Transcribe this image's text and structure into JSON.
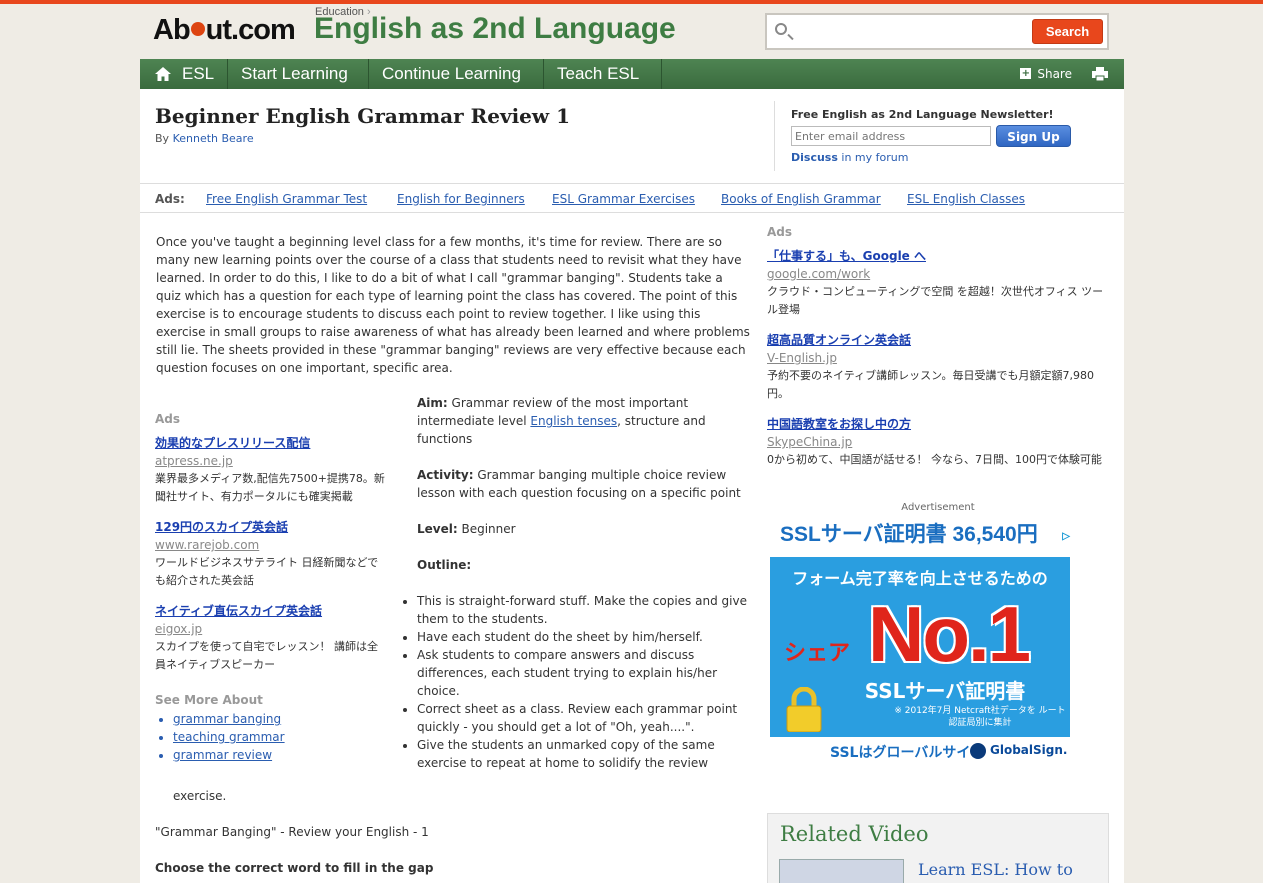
{
  "header": {
    "logo_text_pre": "Ab",
    "logo_text_post": "ut.com",
    "kicker": "Education",
    "kicker_chevron": "›",
    "site_title": "English as 2nd Language",
    "search_placeholder": "",
    "search_button": "Search"
  },
  "nav": {
    "items": [
      "ESL",
      "Start Learning",
      "Continue Learning",
      "Teach ESL"
    ],
    "share": "Share"
  },
  "article": {
    "title": "Beginner English Grammar Review 1",
    "by": "By",
    "author": "Kenneth Beare",
    "intro": "Once you've taught a beginning level class for a few months, it's time for review. There are so many new learning points over the course of a class that students need to revisit what they have learned. In order to do this, I like to do a bit of what I call \"grammar banging\". Students take a quiz which has a question for each type of learning point the class has covered. The point of this exercise is to encourage students to discuss each point to review together. I like using this exercise in small groups to raise awareness of what has already been learned and where problems still lie. The sheets provided in these \"grammar banging\" reviews are very effective because each question focuses on one important, specific area.",
    "aim_label": "Aim:",
    "aim_text_1": " Grammar review of the most important intermediate level ",
    "aim_link": "English tenses",
    "aim_text_2": ", structure and functions",
    "activity_label": "Activity:",
    "activity_text": " Grammar banging multiple choice review lesson with each question focusing on a specific point",
    "level_label": "Level:",
    "level_text": " Beginner",
    "outline_label": "Outline:",
    "outline": [
      "This is straight-forward stuff. Make the copies and give them to the students.",
      "Have each student do the sheet by him/herself.",
      "Ask students to compare answers and discuss differences, each student trying to explain his/her choice.",
      "Correct sheet as a class. Review each grammar point quickly - you should get a lot of \"Oh, yeah....\".",
      "Give the students an unmarked copy of the same exercise to repeat at home to solidify the review"
    ],
    "outline_tail": "exercise.",
    "banging_title": "\"Grammar Banging\" - Review your English - 1",
    "choose": "Choose the correct word to fill in the gap"
  },
  "newsletter": {
    "title": "Free English as 2nd Language Newsletter!",
    "placeholder": "Enter email address",
    "button": "Sign Up",
    "discuss_bold": "Discuss",
    "discuss_rest": " in my forum"
  },
  "ads_bar": {
    "label": "Ads:",
    "links": [
      "Free English Grammar Test",
      "English for Beginners",
      "ESL Grammar Exercises",
      "Books of English Grammar",
      "ESL English Classes"
    ]
  },
  "ads_left": {
    "label": "Ads",
    "items": [
      {
        "title": "効果的なプレスリリース配信",
        "url": "atpress.ne.jp",
        "desc": "業界最多メディア数,配信先7500+提携78。新聞社サイト、有力ポータルにも確実掲載"
      },
      {
        "title": "129円のスカイプ英会話",
        "url": "www.rarejob.com",
        "desc": "ワールドビジネスサテライト 日経新聞などでも紹介された英会話"
      },
      {
        "title": "ネイティブ直伝スカイプ英会話",
        "url": "eigox.jp",
        "desc": "スカイプを使って自宅でレッスン！ 講師は全員ネイティブスピーカー"
      }
    ]
  },
  "see_more": {
    "label": "See More About",
    "links": [
      "grammar banging",
      "teaching grammar",
      "grammar review"
    ]
  },
  "ads_right": {
    "label": "Ads",
    "items": [
      {
        "title": "「仕事する」も、Google へ",
        "url": "google.com/work",
        "desc": "クラウド・コンピューティングで空間 を超越！次世代オフィス ツール登場"
      },
      {
        "title": "超高品質オンライン英会話",
        "url": "V-English.jp",
        "desc": "予約不要のネイティブ講師レッスン。毎日受講でも月額定額7,980円。"
      },
      {
        "title": "中国語教室をお探し中の方",
        "url": "SkypeChina.jp",
        "desc": "0から初めて、中国語が話せる！ 今なら、7日間、100円で体験可能"
      }
    ]
  },
  "banner": {
    "label": "Advertisement",
    "top": "SSLサーバ証明書 36,540円",
    "line1": "フォーム完了率を向上させるための",
    "share": "シェア",
    "no1": "No.1",
    "ssl": "SSLサーバ証明書",
    "note": "※ 2012年7月 Netcraft社データを ルート認証局別に集計",
    "bottom_ssl": "SSLはグローバルサイン",
    "bottom_gs": "GlobalSign."
  },
  "related": {
    "title": "Related Video",
    "link": "Learn ESL: How to"
  },
  "colors": {
    "accent": "#e8471c",
    "nav_green": "#3a6b3e",
    "title_green": "#3e7d43",
    "link_blue": "#2a5db0"
  }
}
